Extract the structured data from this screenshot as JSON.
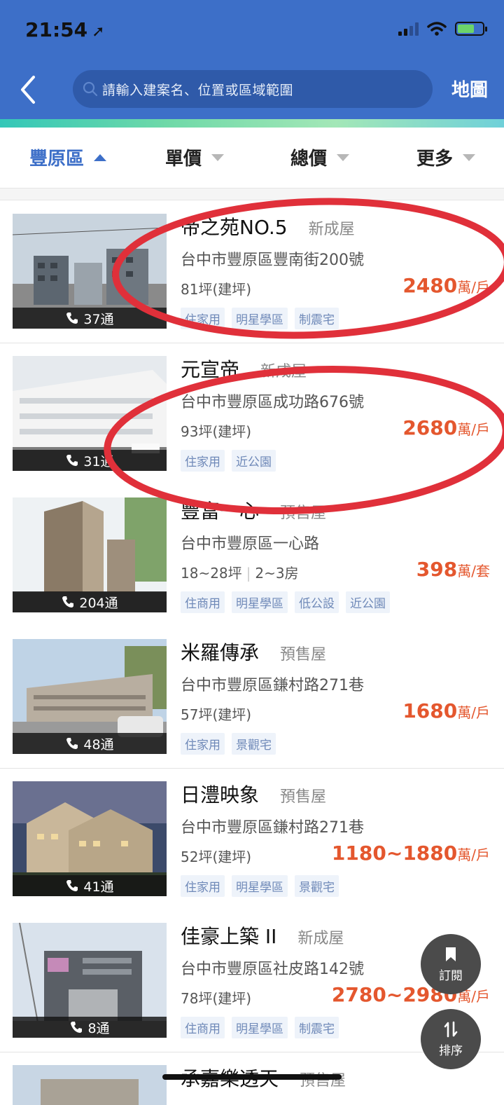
{
  "status_bar": {
    "time": "21:54"
  },
  "header": {
    "search_placeholder": "請輸入建案名、位置或區域範圍",
    "map_label": "地圖"
  },
  "filters": [
    {
      "label": "豐原區",
      "active": true
    },
    {
      "label": "單價",
      "active": false
    },
    {
      "label": "總價",
      "active": false
    },
    {
      "label": "更多",
      "active": false
    }
  ],
  "listings": [
    {
      "name": "帝之苑NO.5",
      "type": "新成屋",
      "address": "台中市豐原區豐南街200號",
      "area": "81坪(建坪)",
      "rooms": "",
      "price": "2480",
      "unit": "萬/戶",
      "tags": [
        "住家用",
        "明星學區",
        "制震宅"
      ],
      "calls": "37通"
    },
    {
      "name": "元宣帝",
      "type": "新成屋",
      "address": "台中市豐原區成功路676號",
      "area": "93坪(建坪)",
      "rooms": "",
      "price": "2680",
      "unit": "萬/戶",
      "tags": [
        "住家用",
        "近公園"
      ],
      "calls": "31通"
    },
    {
      "name": "豐富一心",
      "type": "預售屋",
      "address": "台中市豐原區一心路",
      "area": "18~28坪",
      "rooms": "2~3房",
      "price": "398",
      "unit": "萬/套",
      "tags": [
        "住商用",
        "明星學區",
        "低公設",
        "近公園"
      ],
      "calls": "204通"
    },
    {
      "name": "米羅傳承",
      "type": "預售屋",
      "address": "台中市豐原區鎌村路271巷",
      "area": "57坪(建坪)",
      "rooms": "",
      "price": "1680",
      "unit": "萬/戶",
      "tags": [
        "住家用",
        "景觀宅"
      ],
      "calls": "48通"
    },
    {
      "name": "日澧映象",
      "type": "預售屋",
      "address": "台中市豐原區鎌村路271巷",
      "area": "52坪(建坪)",
      "rooms": "",
      "price": "1180~1880",
      "unit": "萬/戶",
      "tags": [
        "住家用",
        "明星學區",
        "景觀宅"
      ],
      "calls": "41通"
    },
    {
      "name": "佳豪上築 II",
      "type": "新成屋",
      "address": "台中市豐原區社皮路142號",
      "area": "78坪(建坪)",
      "rooms": "",
      "price": "2780~2980",
      "unit": "萬/戶",
      "tags": [
        "住商用",
        "明星學區",
        "制震宅"
      ],
      "calls": "8通"
    },
    {
      "name": "承嘉樂透天",
      "type": "預售屋"
    }
  ],
  "fab": {
    "subscribe_label": "訂閱",
    "sort_label": "排序"
  },
  "colors": {
    "header": "#3d6fc8",
    "price": "#e4572e",
    "annotation": "#e0303a"
  }
}
